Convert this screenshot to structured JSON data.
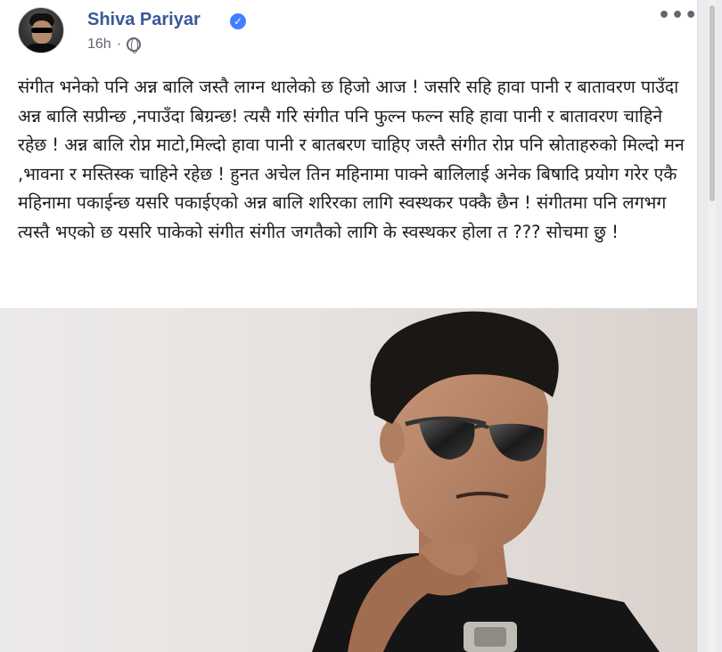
{
  "post": {
    "author": "Shiva Pariyar",
    "verified_icon": "verified-badge-icon",
    "timestamp": "16h",
    "separator": "·",
    "privacy_icon": "globe-icon",
    "more_label": "•••",
    "text": "संगीत भनेको पनि अन्न बालि जस्तै लाग्न थालेको छ हिजो आज ! जसरि सहि हावा पानी र बातावरण पाउँदा अन्न बालि सप्रीन्छ ,नपाउँदा बिग्रन्छ! त्यसै गरि संगीत पनि फुल्न फल्न सहि हावा पानी र बातावरण चाहिने रहेछ ! अन्न बालि रोप्न माटो,मिल्दो हावा पानी र बातबरण चाहिए जस्तै संगीत रोप्न पनि स्रोताहरुको मिल्दो मन ,भावना र मस्तिस्क चाहिने रहेछ ! हुनत अचेल तिन महिनामा पाक्ने बालिलाई अनेक बिषादि प्रयोग गरेर एकै महिनामा पकाईन्छ यसरि पकाईएको अन्न बालि शरिरका लागि स्वस्थकर पक्कै छैन ! संगीतमा पनि लगभग त्यस्तै भएको छ यसरि पाकेको संगीत संगीत जगतैको लागि के स्वस्थकर होला त ??? सोचमा छु !"
  },
  "colors": {
    "name": "#385898",
    "meta": "#606770",
    "text": "#1c1e21",
    "verified": "#4080ff"
  }
}
